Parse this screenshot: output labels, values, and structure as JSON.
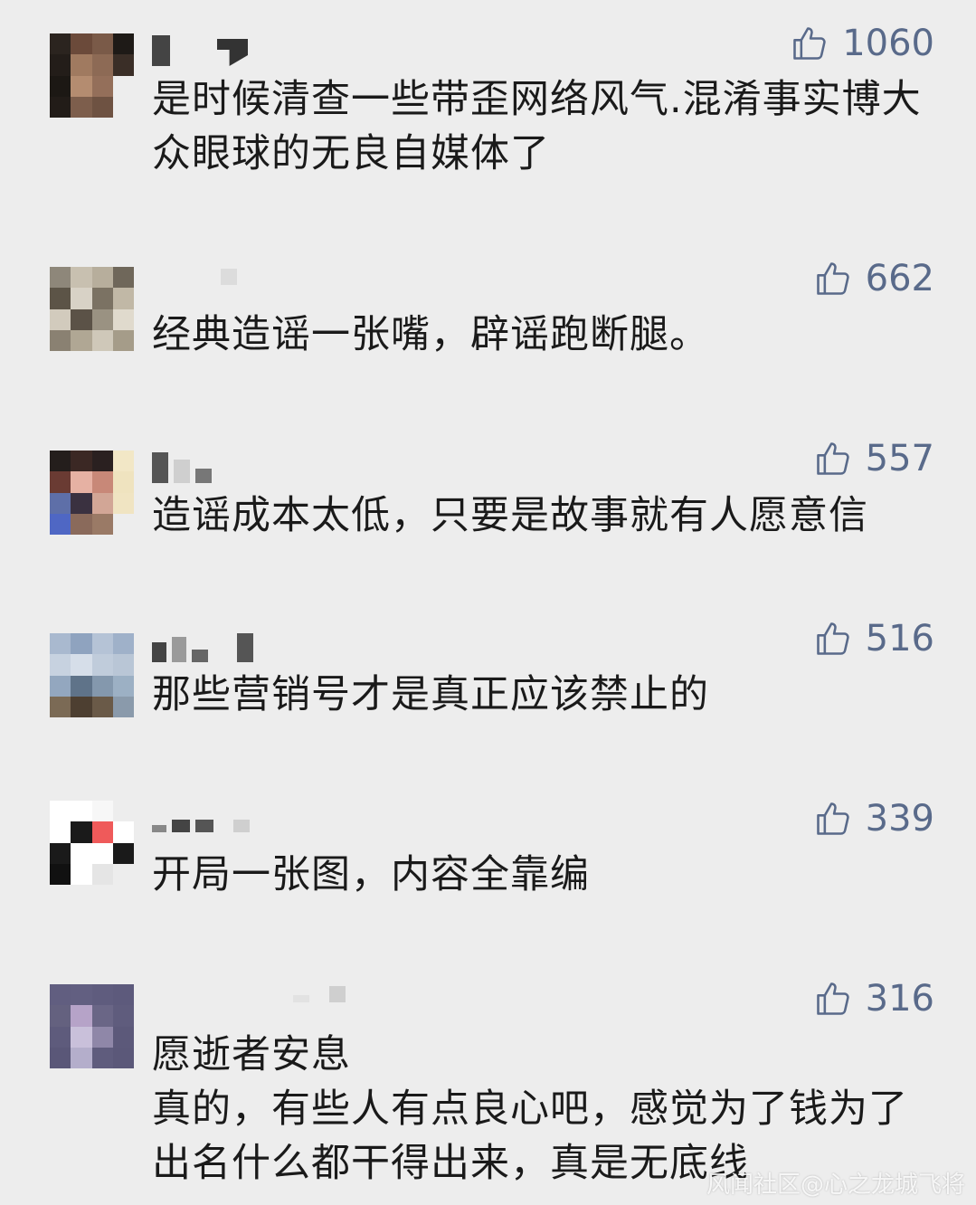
{
  "comments": [
    {
      "likes": "1060",
      "text": "是时候清查一些带歪网络风气.混淆事实博大众眼球的无良自媒体了"
    },
    {
      "likes": "662",
      "text": "经典造谣一张嘴，辟谣跑断腿。"
    },
    {
      "likes": "557",
      "text": "造谣成本太低，只要是故事就有人愿意信"
    },
    {
      "likes": "516",
      "text": "那些营销号才是真正应该禁止的"
    },
    {
      "likes": "339",
      "text": "开局一张图，内容全靠编"
    },
    {
      "likes": "316",
      "text": "愿逝者安息\n真的，有些人有点良心吧，感觉为了钱为了出名什么都干得出来，真是无底线"
    }
  ],
  "icons": {
    "like": "thumbs-up-icon"
  },
  "colors": {
    "background": "#ededed",
    "like": "#596a8a",
    "text": "#1a1a1a"
  },
  "watermark": "风闻社区@心之龙城飞将"
}
